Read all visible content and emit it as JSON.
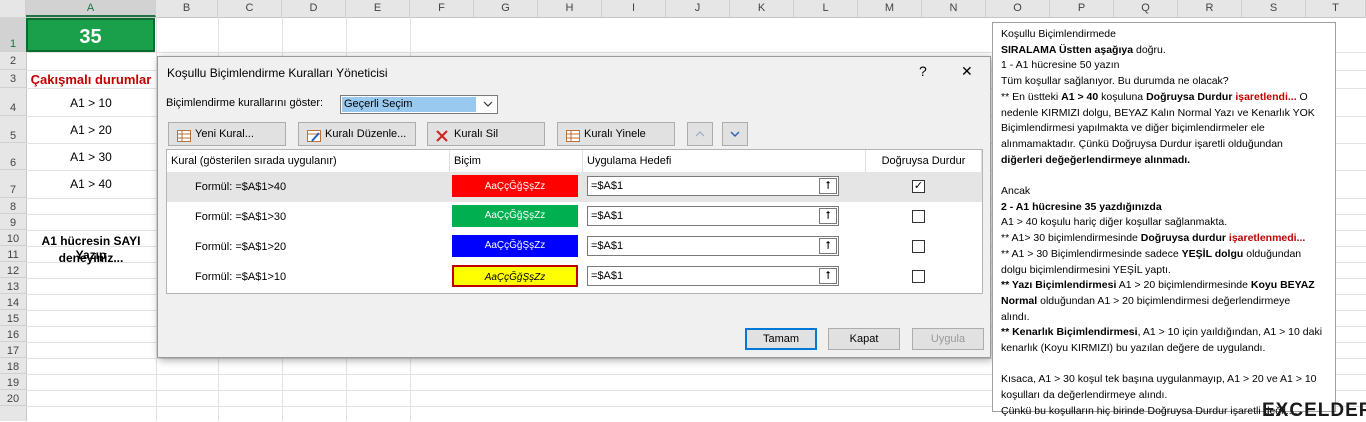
{
  "sheet": {
    "columns": [
      "A",
      "B",
      "C",
      "D",
      "E",
      "F",
      "G",
      "H",
      "I",
      "J",
      "K",
      "L",
      "M",
      "N",
      "O",
      "P",
      "Q",
      "R",
      "S",
      "T"
    ],
    "rows": [
      "1",
      "2",
      "3",
      "4",
      "5",
      "6",
      "7",
      "8",
      "9",
      "10",
      "11",
      "12",
      "13",
      "14",
      "15",
      "16",
      "17",
      "18",
      "19",
      "20"
    ],
    "a1_value": "35",
    "overlap_title": "Çakışmalı durumlar",
    "conditions": [
      "A1 > 10",
      "A1 > 20",
      "A1 > 30",
      "A1 > 40"
    ],
    "instruction_line1": "A1 hücresin SAYI Yazıp",
    "instruction_line2": "deneyiniz..."
  },
  "dialog": {
    "title": "Koşullu Biçimlendirme Kuralları Yöneticisi",
    "help_symbol": "?",
    "close_symbol": "✕",
    "show_label": "Biçimlendirme kurallarını göster:",
    "show_value": "Geçerli Seçim",
    "toolbar": {
      "new_rule": "Yeni Kural...",
      "edit_rule": "Kuralı Düzenle...",
      "delete_rule": "Kuralı Sil",
      "duplicate_rule": "Kuralı Yinele"
    },
    "headers": {
      "rule": "Kural (gösterilen sırada uygulanır)",
      "format": "Biçim",
      "applies_to": "Uygulama Hedefi",
      "stop_if_true": "Doğruysa Durdur"
    },
    "rules": [
      {
        "label": "Formül: =$A$1>40",
        "preview": "AaÇçĞğŞşZz",
        "applies": "=$A$1",
        "checked": "✓",
        "bg": "#ff0000",
        "fg": "#ffffff"
      },
      {
        "label": "Formül: =$A$1>30",
        "preview": "AaÇçĞğŞşZz",
        "applies": "=$A$1",
        "checked": "",
        "bg": "#00b050",
        "fg": "#ffffff"
      },
      {
        "label": "Formül: =$A$1>20",
        "preview": "AaÇçĞğŞşZz",
        "applies": "=$A$1",
        "checked": "",
        "bg": "#0000ff",
        "fg": "#ffffff"
      },
      {
        "label": "Formül: =$A$1>10",
        "preview": "AaÇçĞğŞşZz",
        "applies": "=$A$1",
        "checked": "",
        "bg": "#ffff00",
        "fg": "#000000"
      }
    ],
    "ok": "Tamam",
    "close": "Kapat",
    "apply": "Uygula"
  },
  "notes": {
    "l01": "Koşullu Biçimlendirmede",
    "l02": "SIRALAMA Üstten aşağıya",
    "l02b": " doğru.",
    "l03": "1 - A1 hücresine  50 yazın",
    "l04": "Tüm koşullar sağlanıyor. Bu durumda ne olacak?",
    "l05a": "** En üstteki ",
    "l05b": "A1 > 40",
    "l05c": " koşuluna ",
    "l05d": "Doğruysa Durdur",
    "l05e": " işaretlendi...",
    "l05f": " O",
    "l06": "nedenle KIRMIZI dolgu, BEYAZ Kalın Normal Yazı ve Kenarlık YOK",
    "l07": "Biçimlendirmesi yapılmakta ve diğer biçimlendirmeler ele",
    "l08": "alınmamaktadır. Çünkü Doğruysa Durdur işaretli olduğundan",
    "l09": "diğerleri değeğerlendirmeye alınmadı.",
    "l10": "Ancak",
    "l11": "2 - A1 hücresine 35 yazdığınızda",
    "l12": "A1 > 40 koşulu hariç diğer koşullar sağlanmakta.",
    "l13a": "** A1> 30 biçimlendirmesinde ",
    "l13b": "Doğruysa durdur",
    "l13c": " işaretlenmedi...",
    "l14a": "** A1 > 30 Biçimlendirmesinde sadece ",
    "l14b": "YEŞİL dolgu",
    "l14c": " olduğundan",
    "l15": "dolgu biçimlendirmesini YEŞİL yaptı.",
    "l16a": "** Yazı  Biçimlendirmesi",
    "l16b": " A1 > 20 biçimlendirmesinde ",
    "l16c": "Koyu BEYAZ",
    "l17a": "Normal",
    "l17b": " olduğundan A1 > 20 biçimlendirmesi değerlendirmeye",
    "l18": "alındı.",
    "l19a": "** Kenarlık Biçimlendirmesi",
    "l19b": ", A1 > 10 için yaıldığından, A1 > 10 daki",
    "l20": "kenarlık (Koyu KIRMIZI) bu yazılan değere de uygulandı.",
    "l21": "Kısaca, A1 > 30 koşul tek başına uygulanmayıp, A1 > 20 ve A1 > 10",
    "l22": "koşulları da değerlendirmeye alındı.",
    "l23": "Çünkü bu koşulların hiç birinde Doğruysa Durdur işaretli değil...."
  },
  "watermark": "EXCELDEPO",
  "colors": {
    "accent_green": "#1aa04a",
    "dialog_bg": "#f0f0f0",
    "selection_blue": "#0078d7"
  }
}
